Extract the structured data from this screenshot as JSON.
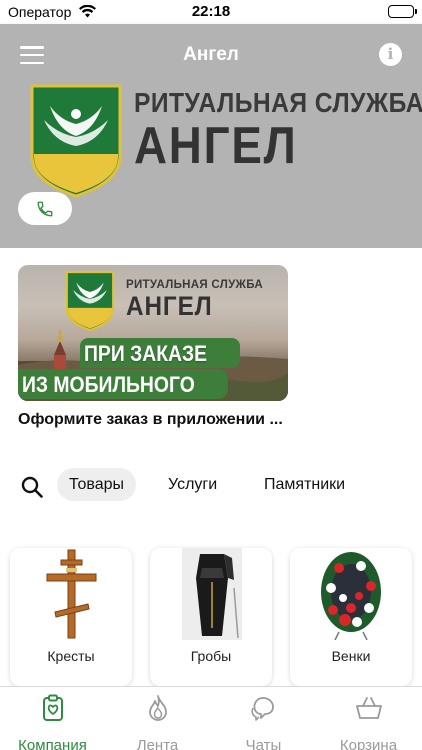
{
  "status_bar": {
    "carrier": "Оператор",
    "time": "22:18"
  },
  "header": {
    "title": "Ангел",
    "logo_line1": "РИТУАЛЬНАЯ СЛУЖБА",
    "logo_line2": "АНГЕЛ"
  },
  "promo": {
    "banner_line1": "РИТУАЛЬНАЯ СЛУЖБА",
    "banner_line2": "АНГЕЛ",
    "banner_line3": "ПРИ ЗАКАЗЕ",
    "banner_line4": "ИЗ МОБИЛЬНОГО",
    "caption": "Оформите заказ в приложении ..."
  },
  "catalog": {
    "tabs": [
      {
        "label": "Товары",
        "active": true
      },
      {
        "label": "Услуги",
        "active": false
      },
      {
        "label": "Памятники",
        "active": false
      }
    ],
    "cards": [
      {
        "label": "Кресты",
        "icon": "cross-icon"
      },
      {
        "label": "Гробы",
        "icon": "coffin-icon"
      },
      {
        "label": "Венки",
        "icon": "wreath-icon"
      }
    ]
  },
  "tabbar": {
    "items": [
      {
        "label": "Компания",
        "icon": "company-icon",
        "active": true
      },
      {
        "label": "Лента",
        "icon": "flame-icon",
        "active": false
      },
      {
        "label": "Чаты",
        "icon": "chat-icon",
        "active": false
      },
      {
        "label": "Корзина",
        "icon": "basket-icon",
        "active": false
      }
    ]
  },
  "colors": {
    "header_bg": "#b3b3b3",
    "accent_green": "#2e8b3f",
    "logo_green": "#1f7a3a",
    "logo_yellow": "#e8c53a"
  }
}
